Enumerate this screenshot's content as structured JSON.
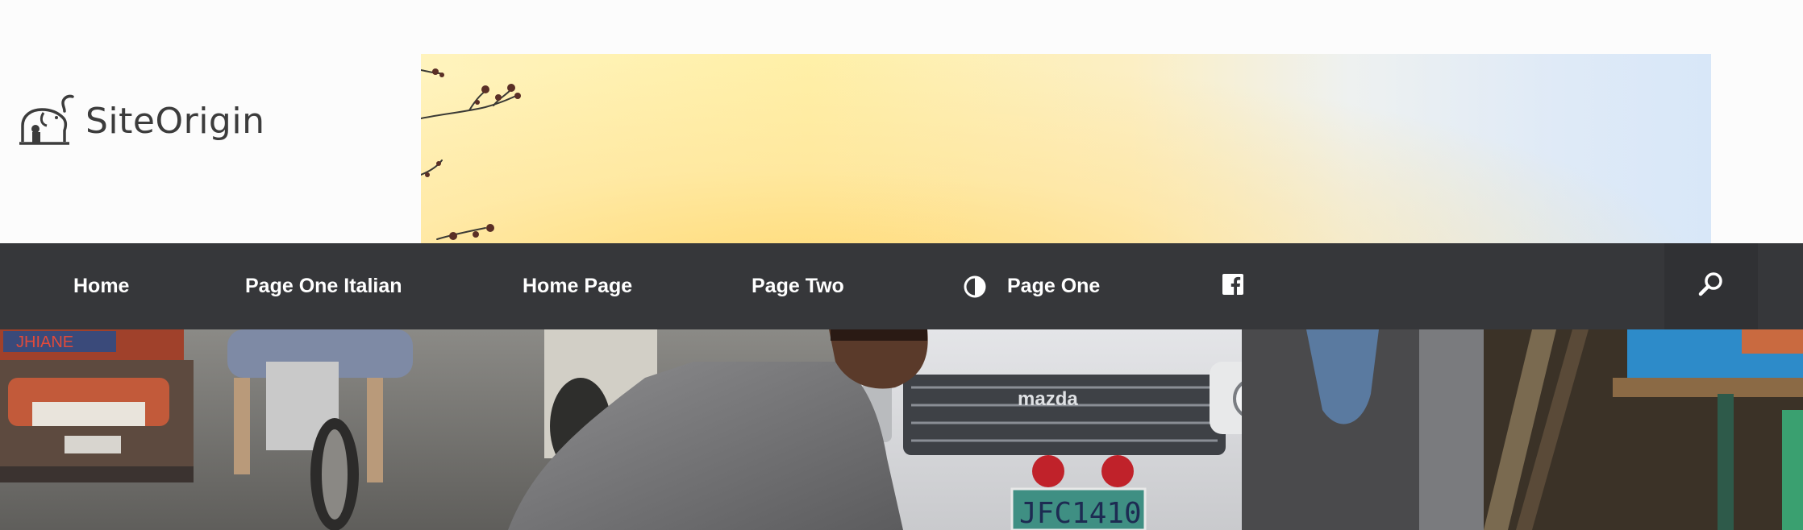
{
  "site": {
    "logo_text": "SiteOrigin"
  },
  "nav": {
    "items": [
      {
        "label": "Home"
      },
      {
        "label": "Page One Italian"
      },
      {
        "label": "Home Page"
      },
      {
        "label": "Page Two"
      },
      {
        "label": "Page One",
        "icon": "half-circle-contrast-icon"
      }
    ],
    "social_icon": "facebook-icon",
    "search_icon": "search-icon"
  },
  "hero": {
    "vehicle_badge": "mazda",
    "plate_text": "JFC1410",
    "sign_text": "JHIANE"
  },
  "colors": {
    "nav_background": "#36373a",
    "nav_text": "#ffffff",
    "page_background": "#fcfcfc"
  }
}
